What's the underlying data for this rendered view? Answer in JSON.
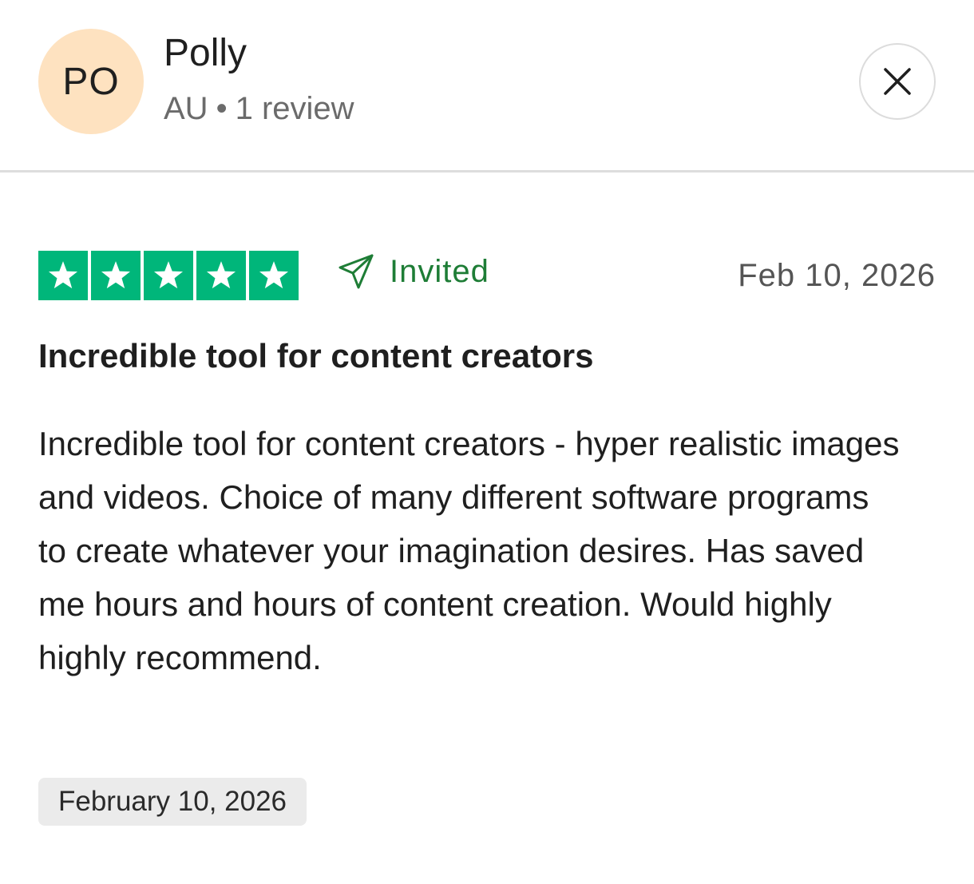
{
  "reviewer": {
    "initials": "PO",
    "name": "Polly",
    "country": "AU",
    "separator": "•",
    "review_count": "1 review",
    "avatar_color": "#fee2c0"
  },
  "close_icon": "close-icon",
  "review": {
    "rating": 5,
    "rating_max": 5,
    "star_color": "#00b67a",
    "invited_label": "Invited",
    "invited_icon": "paper-plane-icon",
    "invited_color": "#1e7d36",
    "date_short": "Feb 10, 2026",
    "title": "Incredible tool for content creators",
    "body": "Incredible tool for content creators - hyper realistic images and videos. Choice of many different software programs to create whatever your imagination desires. Has saved me hours and hours of content creation. Would highly highly recommend.",
    "date_full": "February 10, 2026"
  }
}
